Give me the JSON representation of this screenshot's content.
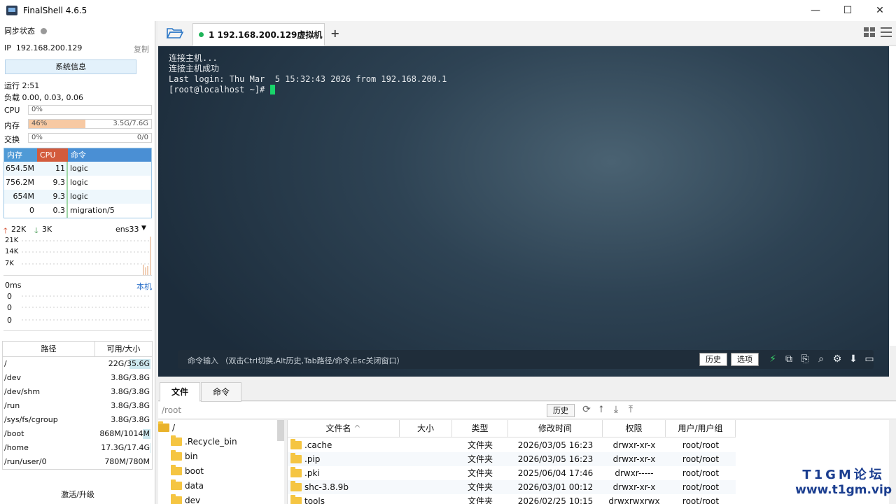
{
  "window": {
    "title": "FinalShell 4.6.5",
    "minimize": "—",
    "maximize": "☐",
    "close": "✕"
  },
  "left": {
    "sync_label": "同步状态",
    "ip_label": "IP",
    "ip": "192.168.200.129",
    "copy_label": "复制",
    "sysinfo_button": "系统信息",
    "uptime": "运行 2:51",
    "load": "负载 0.00, 0.03, 0.06",
    "cpu": {
      "label": "CPU",
      "pct": "0%",
      "value": 0
    },
    "mem": {
      "label": "内存",
      "pct": "46%",
      "value": 46,
      "detail": "3.5G/7.6G"
    },
    "swap": {
      "label": "交换",
      "pct": "0%",
      "value": 0,
      "detail": "0/0"
    },
    "proc_headers": {
      "mem": "内存",
      "cpu": "CPU",
      "cmd": "命令"
    },
    "procs": [
      {
        "mem": "654.5M",
        "cpu": "11",
        "cmd": "logic"
      },
      {
        "mem": "756.2M",
        "cpu": "9.3",
        "cmd": "logic"
      },
      {
        "mem": "654M",
        "cpu": "9.3",
        "cmd": "logic"
      },
      {
        "mem": "0",
        "cpu": "0.3",
        "cmd": "migration/5"
      }
    ],
    "net": {
      "up": "22K",
      "down": "3K",
      "iface": "ens33",
      "ticks": [
        "21K",
        "14K",
        "7K"
      ]
    },
    "ping": {
      "label": "0ms",
      "host": "本机",
      "ticks": [
        "0",
        "0",
        "0"
      ]
    },
    "disk_headers": {
      "path": "路径",
      "size": "可用/大小"
    },
    "disks": [
      {
        "path": "/",
        "size": "22G/35.6G",
        "used": 0.38
      },
      {
        "path": "/dev",
        "size": "3.8G/3.8G",
        "used": 0
      },
      {
        "path": "/dev/shm",
        "size": "3.8G/3.8G",
        "used": 0
      },
      {
        "path": "/run",
        "size": "3.8G/3.8G",
        "used": 0
      },
      {
        "path": "/sys/fs/cgroup",
        "size": "3.8G/3.8G",
        "used": 0
      },
      {
        "path": "/boot",
        "size": "868M/1014M",
        "used": 0.14
      },
      {
        "path": "/home",
        "size": "17.3G/17.4G",
        "used": 0.01
      },
      {
        "path": "/run/user/0",
        "size": "780M/780M",
        "used": 0
      }
    ],
    "activate": "激活/升级"
  },
  "tabs": [
    {
      "label": "1  192.168.200.129虚拟机",
      "close": "×"
    }
  ],
  "add_tab": "+",
  "terminal": {
    "lines": [
      "连接主机...",
      "连接主机成功",
      "Last login: Thu Mar  5 15:32:43 2026 from 192.168.200.1"
    ],
    "prompt": "[root@localhost ~]# "
  },
  "cmdbar": {
    "hint": "命令输入 （双击Ctrl切换,Alt历史,Tab路径/命令,Esc关闭窗口）",
    "history": "历史",
    "options": "选项"
  },
  "bottom_tabs": [
    "文件",
    "命令"
  ],
  "pathbar": {
    "path": "/root",
    "history": "历史"
  },
  "tree": [
    {
      "name": "/",
      "root": true
    },
    {
      "name": ".Recycle_bin"
    },
    {
      "name": "bin"
    },
    {
      "name": "boot"
    },
    {
      "name": "data"
    },
    {
      "name": "dev"
    }
  ],
  "file_headers": [
    "文件名",
    "大小",
    "类型",
    "修改时间",
    "权限",
    "用户/用户组"
  ],
  "files": [
    {
      "name": ".cache",
      "size": "",
      "type": "文件夹",
      "mtime": "2026/03/05 16:23",
      "perm": "drwxr-xr-x",
      "owner": "root/root"
    },
    {
      "name": ".pip",
      "size": "",
      "type": "文件夹",
      "mtime": "2026/03/05 16:23",
      "perm": "drwxr-xr-x",
      "owner": "root/root"
    },
    {
      "name": ".pki",
      "size": "",
      "type": "文件夹",
      "mtime": "2025/06/04 17:46",
      "perm": "drwxr-----",
      "owner": "root/root"
    },
    {
      "name": "shc-3.8.9b",
      "size": "",
      "type": "文件夹",
      "mtime": "2026/03/01 00:12",
      "perm": "drwxr-xr-x",
      "owner": "root/root"
    },
    {
      "name": "tools",
      "size": "",
      "type": "文件夹",
      "mtime": "2026/02/25 10:15",
      "perm": "drwxrwxrwx",
      "owner": "root/root"
    }
  ],
  "watermark": {
    "line1": "T1GM论坛",
    "line2": "www.t1gm.vip"
  },
  "colors": {
    "proc_mem": "#9ec7e6",
    "proc_cpu": "#d35b3c",
    "proc_cmd": "#4a8fd4",
    "accent_green": "#19d46a"
  }
}
